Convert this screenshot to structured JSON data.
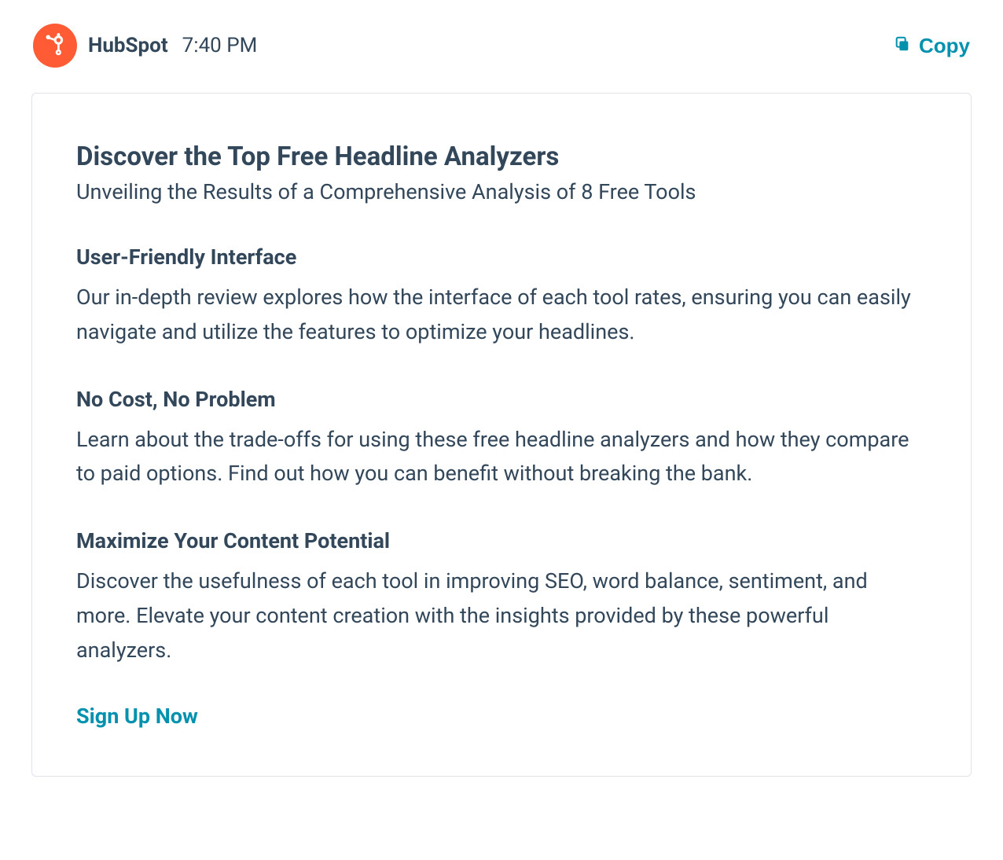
{
  "header": {
    "brand": "HubSpot",
    "timestamp": "7:40 PM",
    "copy_label": "Copy"
  },
  "card": {
    "title": "Discover the Top Free Headline Analyzers",
    "subtitle": "Unveiling the Results of a Comprehensive Analysis of 8 Free Tools",
    "sections": [
      {
        "heading": "User-Friendly Interface",
        "body": "Our in-depth review explores how the interface of each tool rates, ensuring you can easily navigate and utilize the features to optimize your headlines."
      },
      {
        "heading": "No Cost, No Problem",
        "body": "Learn about the trade-offs for using these free headline analyzers and how they compare to paid options. Find out how you can benefit without breaking the bank."
      },
      {
        "heading": "Maximize Your Content Potential",
        "body": "Discover the usefulness of each tool in improving SEO, word balance, sentiment, and more. Elevate your content creation with the insights provided by these powerful analyzers."
      }
    ],
    "cta": "Sign Up Now"
  },
  "colors": {
    "brand_orange": "#ff5c35",
    "text_primary": "#33475b",
    "accent_teal": "#0091ae",
    "border": "#dfe3eb"
  }
}
